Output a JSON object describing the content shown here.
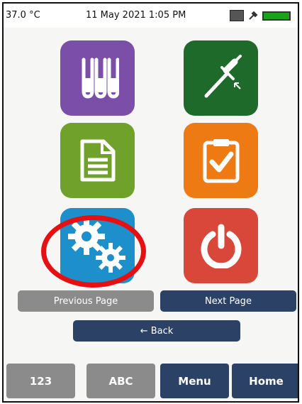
{
  "status": {
    "temperature": "37.0 °C",
    "datetime": "11 May 2021 1:05 PM",
    "battery_color": "#1aa31a"
  },
  "tiles": [
    {
      "icon": "test-tubes-icon",
      "color": "#7b4fa8"
    },
    {
      "icon": "pipette-icon",
      "color": "#1d6a2b"
    },
    {
      "icon": "document-icon",
      "color": "#6fa12b"
    },
    {
      "icon": "clipboard-check-icon",
      "color": "#ee7a14"
    },
    {
      "icon": "gears-icon",
      "color": "#1d8fca",
      "highlighted": true
    },
    {
      "icon": "power-icon",
      "color": "#d9473a"
    }
  ],
  "nav": {
    "previous_label": "Previous Page",
    "next_label": "Next Page",
    "back_label": "← Back"
  },
  "bottom_bar": {
    "numeric_label": "123",
    "alpha_label": "ABC",
    "menu_label": "Menu",
    "home_label": "Home"
  },
  "colors": {
    "primary_button": "#2c4166",
    "disabled_button": "#8b8b8b",
    "highlight_ring": "#e80f12"
  }
}
